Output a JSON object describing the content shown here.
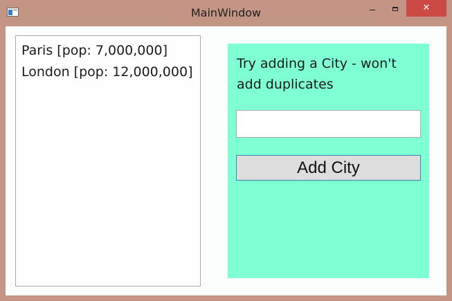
{
  "window": {
    "title": "MainWindow",
    "close_glyph": "✕"
  },
  "cities": [
    {
      "label": "Paris [pop: 7,000,000]"
    },
    {
      "label": "London [pop: 12,000,000]"
    }
  ],
  "panel": {
    "prompt": "Try adding a City - won't add duplicates",
    "input_value": "",
    "button_label": "Add City",
    "background_color": "#7fffd4"
  }
}
